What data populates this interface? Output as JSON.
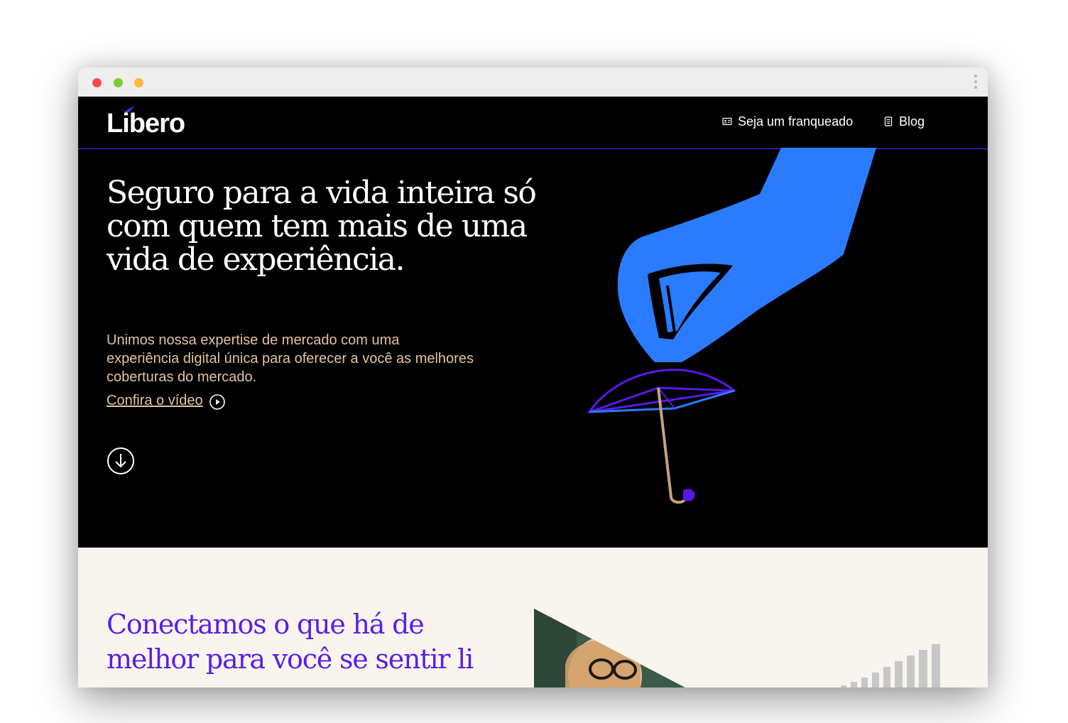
{
  "brand": {
    "name": "Libero",
    "accent": "#2b7bff",
    "purple": "#5a1fe6",
    "gold": "#e3c39e"
  },
  "nav": {
    "franchise_label": "Seja um franqueado",
    "franchise_icon": "id-card-icon",
    "blog_label": "Blog",
    "blog_icon": "document-icon"
  },
  "hero": {
    "title": "Seguro para a vida inteira só com quem tem mais de uma vida de experiência.",
    "subtitle": "Unimos nossa expertise de mercado com uma experiência digital única para oferecer a você as melhores coberturas do mercado.",
    "video_link": "Confira o vídeo",
    "video_icon": "play-circle-icon",
    "scroll_icon": "arrow-down-circle-icon",
    "illustration": "hand-holding-umbrella"
  },
  "section2": {
    "title": "Conectamos o que há de melhor para você se sentir li",
    "image": "woman-with-glasses"
  }
}
